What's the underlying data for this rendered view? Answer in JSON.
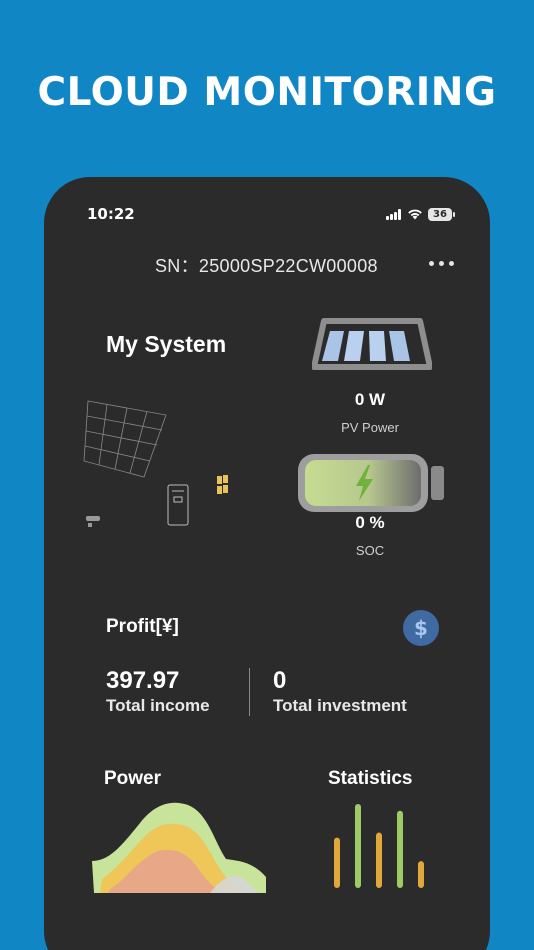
{
  "hero": {
    "title": "CLOUD MONITORING"
  },
  "status_bar": {
    "time": "10:22",
    "battery": "36"
  },
  "device": {
    "sn_text": "SN：25000SP22CW00008"
  },
  "system": {
    "title": "My System"
  },
  "pv": {
    "value": "0 W",
    "label": "PV Power"
  },
  "soc": {
    "value": "0 %",
    "label": "SOC"
  },
  "profit": {
    "title": "Profit[¥]",
    "total_income_value": "397.97",
    "total_income_label": "Total income",
    "total_investment_value": "0",
    "total_investment_label": "Total investment"
  },
  "cards": {
    "power_title": "Power",
    "statistics_title": "Statistics"
  },
  "icons": {
    "signal": "signal-icon",
    "wifi": "wifi-icon",
    "battery": "battery-icon",
    "more": "more-dots-icon",
    "pv": "solar-panel-icon",
    "soc": "battery-charging-icon",
    "dollar": "dollar-icon"
  },
  "colors": {
    "background": "#1186c4",
    "phone": "#2b2b2b",
    "dollar_button": "#3f6aa2",
    "bar_orange": "#e0a83a",
    "bar_green": "#9ccc65"
  },
  "stats_bars": [
    {
      "value": 0.6,
      "color": "#e0a83a"
    },
    {
      "value": 1.0,
      "color": "#9ccc65"
    },
    {
      "value": 0.66,
      "color": "#e0a83a"
    },
    {
      "value": 0.92,
      "color": "#9ccc65"
    },
    {
      "value": 0.32,
      "color": "#e0a83a"
    }
  ]
}
